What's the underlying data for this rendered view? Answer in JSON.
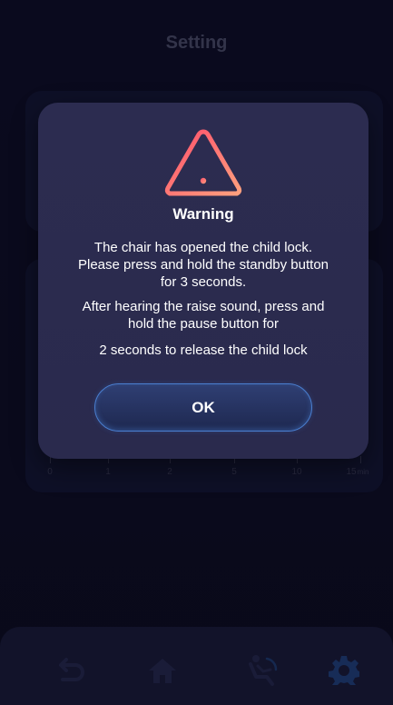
{
  "header": {
    "title": "Setting"
  },
  "timeline": {
    "ticks": [
      {
        "value": "0",
        "unit": ""
      },
      {
        "value": "1",
        "unit": ""
      },
      {
        "value": "2",
        "unit": ""
      },
      {
        "value": "5",
        "unit": ""
      },
      {
        "value": "10",
        "unit": ""
      },
      {
        "value": "15",
        "unit": "min"
      }
    ]
  },
  "dialog": {
    "icon": "warning-triangle-icon",
    "title": "Warning",
    "lines": [
      "The chair has opened the child lock.",
      "Please press and hold the standby button",
      "for 3 seconds.",
      "After hearing the raise sound, press and",
      "hold the pause button for",
      "2 seconds to release the child lock"
    ],
    "ok_label": "OK"
  },
  "nav": {
    "items": [
      {
        "icon": "back-arrow-icon"
      },
      {
        "icon": "home-icon"
      },
      {
        "icon": "massage-chair-icon"
      },
      {
        "icon": "gear-icon"
      }
    ]
  },
  "colors": {
    "background": "#0b0b1f",
    "dialog": "#2b2b4e",
    "accent": "#2f8bff",
    "warning_gradient_start": "#ff5a6e",
    "warning_gradient_end": "#ff9a7a"
  }
}
